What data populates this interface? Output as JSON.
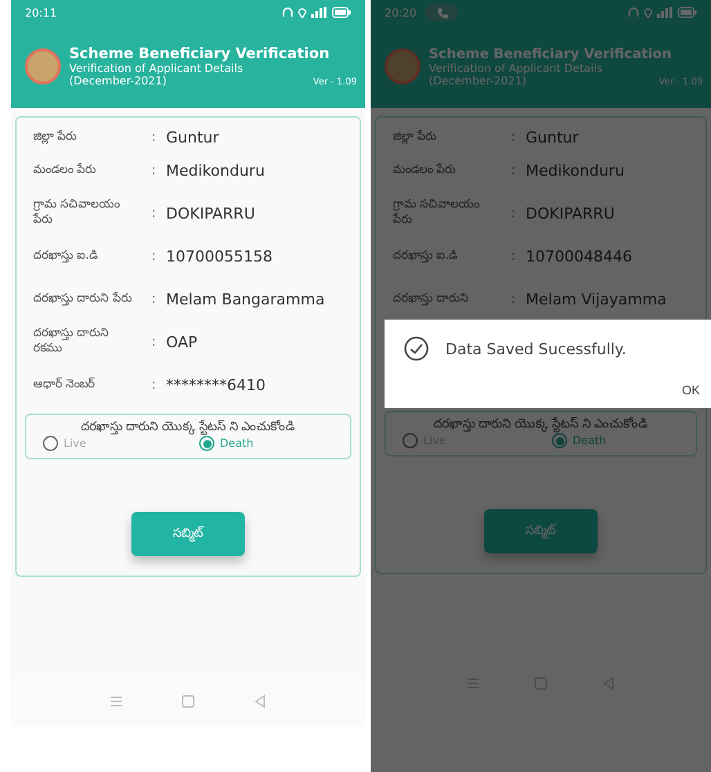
{
  "phones": [
    {
      "status_bar": {
        "time": "20:11",
        "call_active": false
      },
      "header": {
        "title": "Scheme Beneficiary Verification",
        "subtitle": "Verification of Applicant Details",
        "period": "(December-2021)",
        "version": "Ver - 1.09"
      },
      "fields": [
        {
          "label": "జిల్లా పేరు",
          "separator": ":",
          "value": "Guntur"
        },
        {
          "label": "మండలం పేరు",
          "separator": ":",
          "value": "Medikonduru"
        },
        {
          "label": "గ్రామ సచివాలయం పేరు",
          "separator": ":",
          "value": "DOKIPARRU"
        },
        {
          "label": "దరఖాస్తు ఐ.డి",
          "separator": ":",
          "value": "10700055158"
        },
        {
          "label": "దరఖాస్తు దారుని పేరు",
          "separator": ":",
          "value": "Melam Bangaramma"
        },
        {
          "label": "దరఖాస్తు దారుని రకము",
          "separator": ":",
          "value": "OAP"
        },
        {
          "label": "ఆధార్ నెంబర్",
          "separator": ":",
          "value": "********6410"
        }
      ],
      "status_group": {
        "heading": "దరఖాస్తు దారుని యొక్క స్టేటస్ ని ఎంచుకోండి",
        "options": [
          {
            "label": "Live",
            "selected": false
          },
          {
            "label": "Death",
            "selected": true
          }
        ]
      },
      "submit": "సబ్మిట్",
      "dimmed": false
    },
    {
      "status_bar": {
        "time": "20:20",
        "call_active": true
      },
      "header": {
        "title": "Scheme Beneficiary Verification",
        "subtitle": "Verification of Applicant Details",
        "period": "(December-2021)",
        "version": "Ver - 1.09"
      },
      "fields": [
        {
          "label": "జిల్లా పేరు",
          "separator": ":",
          "value": "Guntur"
        },
        {
          "label": "మండలం పేరు",
          "separator": ":",
          "value": "Medikonduru"
        },
        {
          "label": "గ్రామ సచివాలయం పేరు",
          "separator": ":",
          "value": "DOKIPARRU"
        },
        {
          "label": "దరఖాస్తు ఐ.డి",
          "separator": ":",
          "value": "10700048446"
        },
        {
          "label": "దరఖాస్తు దారుని",
          "separator": ":",
          "value": "Melam Vijayamma"
        }
      ],
      "dialog": {
        "message": "Data Saved Sucessfully.",
        "button": "OK"
      },
      "status_group": {
        "heading": "దరఖాస్తు దారుని యొక్క స్టేటస్ ని ఎంచుకోండి",
        "options": [
          {
            "label": "Live",
            "selected": false
          },
          {
            "label": "Death",
            "selected": true
          }
        ]
      },
      "submit": "సబ్మిట్",
      "dimmed": true
    }
  ]
}
